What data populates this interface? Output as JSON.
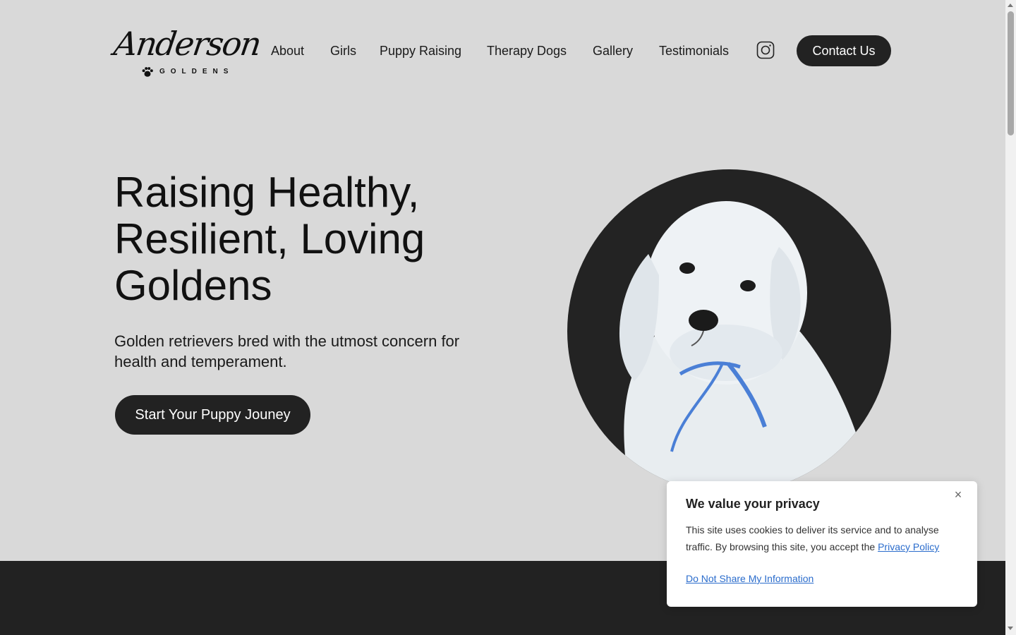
{
  "logo": {
    "script": "Anderson",
    "sub": "GOLDENS",
    "icon": "paw-icon"
  },
  "nav": {
    "items": [
      {
        "label": "About"
      },
      {
        "label": "Girls"
      },
      {
        "label": "Puppy Raising"
      },
      {
        "label": "Therapy Dogs"
      },
      {
        "label": "Gallery"
      },
      {
        "label": "Testimonials"
      }
    ],
    "instagram_icon": "instagram-icon",
    "contact_label": "Contact Us"
  },
  "hero": {
    "title_line1": "Raising Healthy,",
    "title_line2": "Resilient, Loving",
    "title_line3": "Goldens",
    "subtitle": "Golden retrievers bred with the utmost concern for health and temperament.",
    "cta_label": "Start Your Puppy Jouney"
  },
  "privacy": {
    "title": "We value your privacy",
    "text": "This site uses cookies to deliver its service and to analyse traffic. By browsing this site, you accept the",
    "policy_link": "Privacy Policy",
    "dns_link": "Do Not Share My Information",
    "close_icon": "close-icon"
  },
  "colors": {
    "background": "#d9d9d9",
    "dark": "#222222",
    "link": "#2a6ccc"
  }
}
